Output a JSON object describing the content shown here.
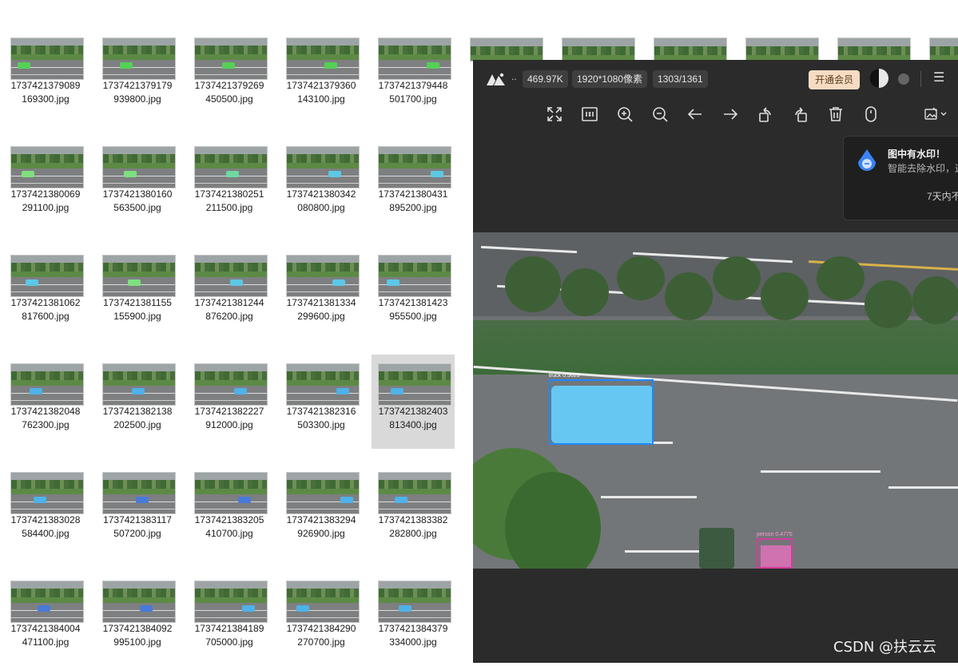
{
  "explorer": {
    "files": [
      [
        "1737421379089",
        "169300.jpg"
      ],
      [
        "1737421379179",
        "939800.jpg"
      ],
      [
        "1737421379269",
        "450500.jpg"
      ],
      [
        "1737421379360",
        "143100.jpg"
      ],
      [
        "1737421379448",
        "501700.jpg"
      ],
      [
        "1737421380069",
        "291100.jpg"
      ],
      [
        "1737421380160",
        "563500.jpg"
      ],
      [
        "1737421380251",
        "211500.jpg"
      ],
      [
        "1737421380342",
        "080800.jpg"
      ],
      [
        "1737421380431",
        "895200.jpg"
      ],
      [
        "1737421381062",
        "817600.jpg"
      ],
      [
        "1737421381155",
        "155900.jpg"
      ],
      [
        "1737421381244",
        "876200.jpg"
      ],
      [
        "1737421381334",
        "299600.jpg"
      ],
      [
        "1737421381423",
        "955500.jpg"
      ],
      [
        "1737421382048",
        "762300.jpg"
      ],
      [
        "1737421382138",
        "202500.jpg"
      ],
      [
        "1737421382227",
        "912000.jpg"
      ],
      [
        "1737421382316",
        "503300.jpg"
      ],
      [
        "1737421382403",
        "813400.jpg"
      ],
      [
        "1737421383028",
        "584400.jpg"
      ],
      [
        "1737421383117",
        "507200.jpg"
      ],
      [
        "1737421383205",
        "410700.jpg"
      ],
      [
        "1737421383294",
        "926900.jpg"
      ],
      [
        "1737421383382",
        "282800.jpg"
      ],
      [
        "1737421384004",
        "471100.jpg"
      ],
      [
        "1737421384092",
        "995100.jpg"
      ],
      [
        "1737421384189",
        "705000.jpg"
      ],
      [
        "1737421384290",
        "270700.jpg"
      ],
      [
        "1737421384379",
        "334000.jpg"
      ]
    ],
    "selected_index": 19,
    "car_colors": [
      "#55d055",
      "#55d055",
      "#55d055",
      "#55d055",
      "#55d055",
      "#7ee07e",
      "#7ee07e",
      "#6ed8a0",
      "#5dc7e6",
      "#5dc7e6",
      "#5dc7e6",
      "#7ee07e",
      "#5dc7e6",
      "#5dc7e6",
      "#5dc7e6",
      "#4fb2e8",
      "#4fb2e8",
      "#4fb2e8",
      "#4fb2e8",
      "#4fb2e8",
      "#4fb2e8",
      "#4a7ad8",
      "#4a7ad8",
      "#4fb2e8",
      "#4fb2e8",
      "#4a7ad8",
      "#4a7ad8",
      "#4fb2e8",
      "#4fb2e8",
      "#4fb2e8"
    ]
  },
  "viewer": {
    "dots": "..",
    "file_size": "469.97K",
    "resolution": "1920*1080像素",
    "counter": "1303/1361",
    "vip_label": "开通会员",
    "menu_glyph": "☰",
    "watermark": {
      "title": "图中有水印！",
      "desc": "智能去除水印，这",
      "footer": "7天内不"
    },
    "detections": [
      {
        "label": "truck  0.5023"
      },
      {
        "label": "person  0.4775"
      }
    ],
    "toolbar_icons": [
      "fit-screen-icon",
      "actual-size-icon",
      "zoom-in-icon",
      "zoom-out-icon",
      "arrow-left-icon",
      "arrow-right-icon",
      "rotate-left-icon",
      "rotate-right-icon",
      "delete-icon",
      "mouse-icon",
      "edit-image-icon"
    ]
  },
  "watermark_text": "CSDN @扶云云"
}
